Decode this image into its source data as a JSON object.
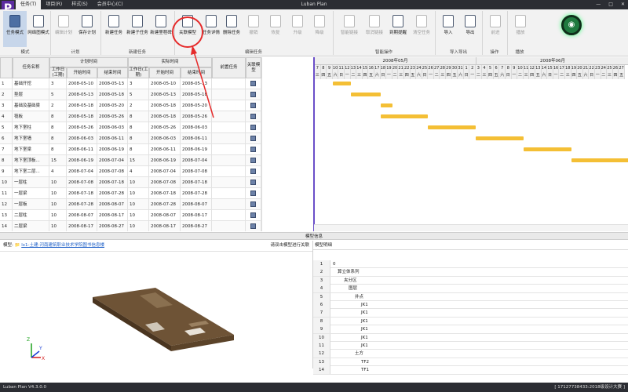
{
  "app": {
    "title": "Luban Plan",
    "logo": "P",
    "version": "Luban Plan V4.3.0.0",
    "status_right": "[ 17127738433:2018级设计大赛 ]",
    "avatar_icon": "user-avatar-icon"
  },
  "menu_tabs": [
    "任务(T)",
    "项目(R)",
    "样式(S)",
    "会员中心(C)"
  ],
  "window_buttons": [
    "—",
    "□",
    "✕"
  ],
  "ribbon": {
    "buttons": [
      {
        "label": "任务模式",
        "icon": "task-mode-icon"
      },
      {
        "label": "网络图模式",
        "icon": "network-mode-icon"
      },
      {
        "label": "编辑计划",
        "icon": "edit-plan-icon"
      },
      {
        "label": "保存计划",
        "icon": "save-plan-icon"
      },
      {
        "label": "新建任务",
        "icon": "new-task-icon"
      },
      {
        "label": "新建子任务",
        "icon": "new-subtask-icon"
      },
      {
        "label": "新建里程碑",
        "icon": "milestone-icon"
      },
      {
        "label": "关联模型",
        "icon": "link-model-icon"
      },
      {
        "label": "任务详情",
        "icon": "task-detail-icon"
      },
      {
        "label": "删除任务",
        "icon": "delete-task-icon"
      },
      {
        "label": "撤销",
        "icon": "undo-icon"
      },
      {
        "label": "恢复",
        "icon": "redo-icon"
      },
      {
        "label": "升级",
        "icon": "upgrade-icon"
      },
      {
        "label": "降级",
        "icon": "downgrade-icon"
      },
      {
        "label": "智能链接",
        "icon": "smart-link-icon"
      },
      {
        "label": "取消链接",
        "icon": "unlink-icon"
      },
      {
        "label": "到期提醒",
        "icon": "reminder-icon"
      },
      {
        "label": "清空任务",
        "icon": "clear-icon"
      },
      {
        "label": "导入",
        "icon": "import-icon"
      },
      {
        "label": "导出",
        "icon": "export-icon"
      },
      {
        "label": "前进",
        "icon": "forward-icon"
      },
      {
        "label": "播放",
        "icon": "play-icon"
      }
    ],
    "groups": [
      "模式",
      "计划",
      "新建任务",
      "编辑任务",
      "智能操作",
      "导入导出",
      "操作",
      "播放"
    ]
  },
  "grid": {
    "headers": {
      "name": "任务名称",
      "plan": "计划时间",
      "actual": "实际时间",
      "work": "工作日(工期)",
      "start": "开始时间",
      "end": "结束时间",
      "pred": "前置任务",
      "model": "关联模型"
    },
    "rows": [
      {
        "no": "1",
        "name": "基础开挖",
        "pw": "3",
        "ps": "2008-05-10",
        "pe": "2008-05-13",
        "aw": "3",
        "as": "2008-05-10",
        "ae": "2008-05-13"
      },
      {
        "no": "2",
        "name": "垫层",
        "pw": "5",
        "ps": "2008-05-13",
        "pe": "2008-05-18",
        "aw": "5",
        "as": "2008-05-13",
        "ae": "2008-05-18"
      },
      {
        "no": "3",
        "name": "基础及基础梁",
        "pw": "2",
        "ps": "2008-05-18",
        "pe": "2008-05-20",
        "aw": "2",
        "as": "2008-05-18",
        "ae": "2008-05-20"
      },
      {
        "no": "4",
        "name": "筏板",
        "pw": "8",
        "ps": "2008-05-18",
        "pe": "2008-05-26",
        "aw": "8",
        "as": "2008-05-18",
        "ae": "2008-05-26"
      },
      {
        "no": "5",
        "name": "地下室柱",
        "pw": "8",
        "ps": "2008-05-26",
        "pe": "2008-06-03",
        "aw": "8",
        "as": "2008-05-26",
        "ae": "2008-06-03"
      },
      {
        "no": "6",
        "name": "地下室墙",
        "pw": "8",
        "ps": "2008-06-03",
        "pe": "2008-06-11",
        "aw": "8",
        "as": "2008-06-03",
        "ae": "2008-06-11"
      },
      {
        "no": "7",
        "name": "地下室梁",
        "pw": "8",
        "ps": "2008-06-11",
        "pe": "2008-06-19",
        "aw": "8",
        "as": "2008-06-11",
        "ae": "2008-06-19"
      },
      {
        "no": "8",
        "name": "地下室顶板...",
        "pw": "15",
        "ps": "2008-06-19",
        "pe": "2008-07-04",
        "aw": "15",
        "as": "2008-06-19",
        "ae": "2008-07-04"
      },
      {
        "no": "9",
        "name": "地下室二层...",
        "pw": "4",
        "ps": "2008-07-04",
        "pe": "2008-07-08",
        "aw": "4",
        "as": "2008-07-04",
        "ae": "2008-07-08"
      },
      {
        "no": "10",
        "name": "一层柱",
        "pw": "10",
        "ps": "2008-07-08",
        "pe": "2008-07-18",
        "aw": "10",
        "as": "2008-07-08",
        "ae": "2008-07-18"
      },
      {
        "no": "11",
        "name": "一层梁",
        "pw": "10",
        "ps": "2008-07-18",
        "pe": "2008-07-28",
        "aw": "10",
        "as": "2008-07-18",
        "ae": "2008-07-28"
      },
      {
        "no": "12",
        "name": "一层板",
        "pw": "10",
        "ps": "2008-07-28",
        "pe": "2008-08-07",
        "aw": "10",
        "as": "2008-07-28",
        "ae": "2008-08-07"
      },
      {
        "no": "13",
        "name": "二层柱",
        "pw": "10",
        "ps": "2008-08-07",
        "pe": "2008-08-17",
        "aw": "10",
        "as": "2008-08-07",
        "ae": "2008-08-17"
      },
      {
        "no": "14",
        "name": "二层梁",
        "pw": "10",
        "ps": "2008-08-17",
        "pe": "2008-08-27",
        "aw": "10",
        "as": "2008-08-17",
        "ae": "2008-08-27"
      }
    ]
  },
  "gantt": {
    "months": [
      "2008年05月",
      "2008年06月"
    ],
    "day_numbers": [
      "7",
      "8",
      "9",
      "10",
      "11",
      "12",
      "13",
      "14",
      "15",
      "16",
      "17",
      "18",
      "19",
      "20",
      "21",
      "22",
      "23",
      "24",
      "25",
      "26",
      "27",
      "28",
      "29",
      "30",
      "31",
      "1",
      "2",
      "3",
      "4",
      "5",
      "6",
      "7",
      "8",
      "9",
      "10",
      "11",
      "12",
      "13",
      "14",
      "15",
      "16",
      "17",
      "18",
      "19",
      "20",
      "21",
      "22",
      "23",
      "24",
      "25",
      "26",
      "27"
    ],
    "weekdays": [
      "三",
      "四",
      "五",
      "六",
      "日",
      "一",
      "二",
      "三",
      "四",
      "五",
      "六",
      "日",
      "一",
      "二",
      "三",
      "四",
      "五",
      "六",
      "日",
      "一",
      "二",
      "三",
      "四",
      "五",
      "六",
      "日",
      "一",
      "二",
      "三",
      "四",
      "五",
      "六",
      "日",
      "一",
      "二",
      "三",
      "四",
      "五",
      "六",
      "日",
      "一",
      "二",
      "三",
      "四",
      "五",
      "六",
      "日",
      "一",
      "二",
      "三",
      "四",
      "五"
    ],
    "bar_color": "#f4bf35"
  },
  "model_panel": {
    "title": "模型信息",
    "label": "模型:",
    "path": "lx1-土建-河南建筑职业技术学院图书信息楼",
    "hint": "请双击模型进行关联",
    "tree_title": "模型明细",
    "tree": [
      "0",
      "算立体系列",
      "夹分区",
      "图层",
      "井点",
      "JK1",
      "JK1",
      "JK1",
      "JK1",
      "JK1",
      "JK1",
      "土方",
      "TF2",
      "TF1"
    ]
  },
  "axes": {
    "x": "X",
    "y": "Y",
    "z": "Z"
  }
}
